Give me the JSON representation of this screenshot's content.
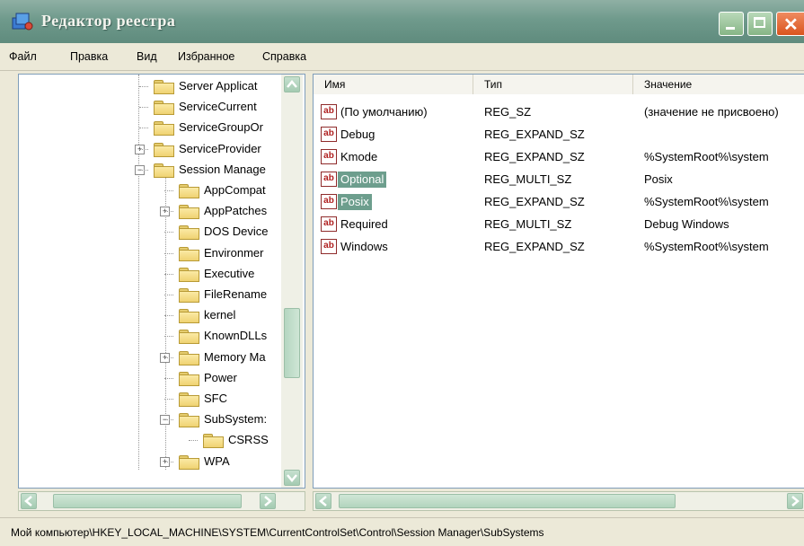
{
  "window": {
    "title": "Редактор реестра"
  },
  "menu": [
    "Файл",
    "Правка",
    "Вид",
    "Избранное",
    "Справка"
  ],
  "tree": [
    {
      "label": "Server Applicat",
      "level": 1,
      "expander": ""
    },
    {
      "label": "ServiceCurrent",
      "level": 1,
      "expander": ""
    },
    {
      "label": "ServiceGroupOr",
      "level": 1,
      "expander": ""
    },
    {
      "label": "ServiceProvider",
      "level": 1,
      "expander": "+"
    },
    {
      "label": "Session Manage",
      "level": 1,
      "expander": "−"
    },
    {
      "label": "AppCompat",
      "level": 2,
      "expander": ""
    },
    {
      "label": "AppPatches",
      "level": 2,
      "expander": "+"
    },
    {
      "label": "DOS Device",
      "level": 2,
      "expander": ""
    },
    {
      "label": "Environmer",
      "level": 2,
      "expander": ""
    },
    {
      "label": "Executive",
      "level": 2,
      "expander": ""
    },
    {
      "label": "FileRename",
      "level": 2,
      "expander": ""
    },
    {
      "label": "kernel",
      "level": 2,
      "expander": ""
    },
    {
      "label": "KnownDLLs",
      "level": 2,
      "expander": ""
    },
    {
      "label": "Memory Ma",
      "level": 2,
      "expander": "+"
    },
    {
      "label": "Power",
      "level": 2,
      "expander": ""
    },
    {
      "label": "SFC",
      "level": 2,
      "expander": ""
    },
    {
      "label": "SubSystem:",
      "level": 2,
      "expander": "−"
    },
    {
      "label": "CSRSS",
      "level": 3,
      "expander": ""
    },
    {
      "label": "WPA",
      "level": 2,
      "expander": "+"
    }
  ],
  "list": {
    "columns": [
      "Имя",
      "Тип",
      "Значение"
    ],
    "rows": [
      {
        "name": "(По умолчанию)",
        "type": "REG_SZ",
        "value": "(значение не присвоено)",
        "selected": false
      },
      {
        "name": "Debug",
        "type": "REG_EXPAND_SZ",
        "value": "",
        "selected": false
      },
      {
        "name": "Kmode",
        "type": "REG_EXPAND_SZ",
        "value": "%SystemRoot%\\system",
        "selected": false
      },
      {
        "name": "Optional",
        "type": "REG_MULTI_SZ",
        "value": "Posix",
        "selected": true
      },
      {
        "name": "Posix",
        "type": "REG_EXPAND_SZ",
        "value": "%SystemRoot%\\system",
        "selected": true
      },
      {
        "name": "Required",
        "type": "REG_MULTI_SZ",
        "value": "Debug Windows",
        "selected": false
      },
      {
        "name": "Windows",
        "type": "REG_EXPAND_SZ",
        "value": "%SystemRoot%\\system",
        "selected": false
      }
    ]
  },
  "icons": {
    "string_value": "ab"
  },
  "status": {
    "path": "Мой компьютер\\HKEY_LOCAL_MACHINE\\SYSTEM\\CurrentControlSet\\Control\\Session Manager\\SubSystems"
  },
  "colors": {
    "titlebar": "#6f9a8c",
    "selection": "#6d9e8d",
    "scroll": "#b2d4bd"
  }
}
